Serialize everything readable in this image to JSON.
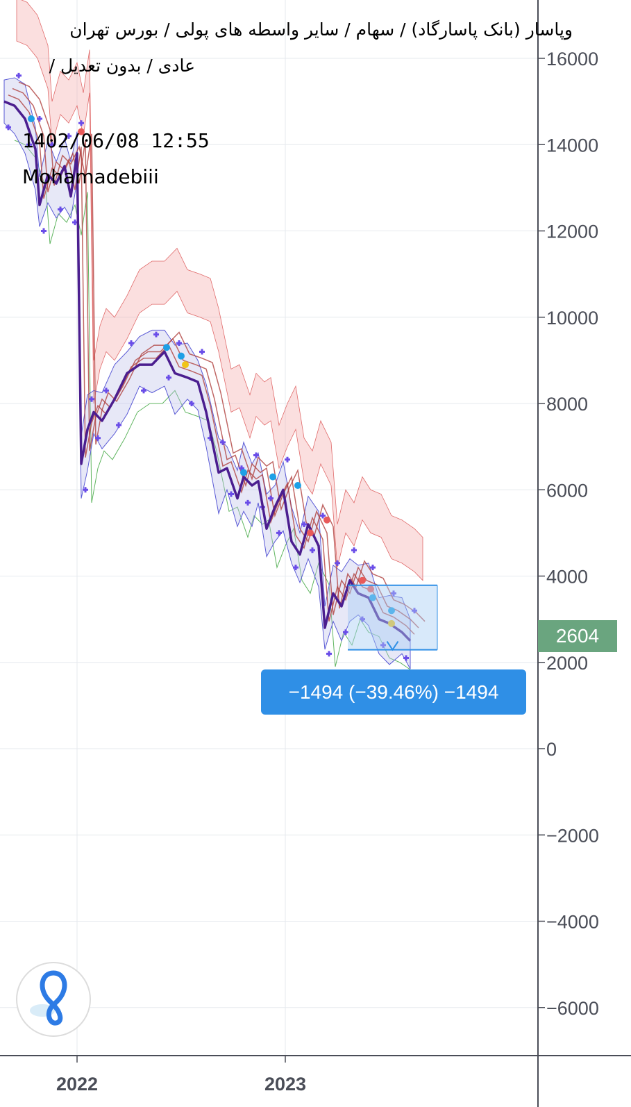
{
  "header": {
    "title_line1": "وپاسار (بانک پاسارگاد) / سهام / سایر واسطه های پولی / بورس تهران",
    "title_line2": "عادی / بدون تعدیل /",
    "datetime": "1402/06/08 12:55",
    "author": "Mohamadebiii"
  },
  "price_badge": {
    "value": "2604",
    "color": "#6aa57f"
  },
  "measurement": {
    "label": "−1494 (−39.46%) −1494",
    "change": -1494,
    "change_percent": -39.46,
    "from_price": 3786,
    "to_price": 2292,
    "color": "#2f8fe6"
  },
  "colors": {
    "price": "#4b1e8f",
    "psar": "#6a4de8",
    "cloud_red": "#f3a3a3",
    "cloud_green": "#8fd08f",
    "bollinger": "#5a5ad6",
    "moving_avg": "#b0413e",
    "grid": "#e6e9ee",
    "axis": "#4a4d57"
  },
  "logo": {
    "icon": "app-logo-icon"
  },
  "chart_data": {
    "type": "line",
    "title": "وپاسار (بانک پاسارگاد) / سهام / سایر واسطه های پولی / بورس تهران",
    "ylim": [
      -7000,
      17000
    ],
    "yticks": [
      16000,
      14000,
      12000,
      10000,
      8000,
      6000,
      4000,
      2000,
      0,
      -2000,
      -4000,
      -6000
    ],
    "xticks": [
      "2022",
      "2023"
    ],
    "grid": true,
    "last_price": 2604,
    "series": [
      {
        "values": [
          [
            2021.65,
            15000
          ],
          [
            2021.7,
            14900
          ],
          [
            2021.75,
            14600
          ],
          [
            2021.8,
            13900
          ],
          [
            2021.82,
            12600
          ],
          [
            2021.86,
            13300
          ],
          [
            2021.9,
            13100
          ],
          [
            2021.94,
            13500
          ],
          [
            2021.97,
            12800
          ],
          [
            2022.0,
            13800
          ],
          [
            2022.02,
            6600
          ],
          [
            2022.05,
            7400
          ],
          [
            2022.08,
            7800
          ],
          [
            2022.12,
            7600
          ],
          [
            2022.18,
            8100
          ],
          [
            2022.24,
            8700
          ],
          [
            2022.3,
            8900
          ],
          [
            2022.36,
            8900
          ],
          [
            2022.42,
            9200
          ],
          [
            2022.47,
            8700
          ],
          [
            2022.53,
            8600
          ],
          [
            2022.58,
            8500
          ],
          [
            2022.62,
            7800
          ],
          [
            2022.68,
            6400
          ],
          [
            2022.72,
            6500
          ],
          [
            2022.77,
            5800
          ],
          [
            2022.8,
            6300
          ],
          [
            2022.84,
            6100
          ],
          [
            2022.87,
            6200
          ],
          [
            2022.91,
            5100
          ],
          [
            2022.95,
            5600
          ],
          [
            2022.99,
            6000
          ],
          [
            2023.03,
            4800
          ],
          [
            2023.07,
            4500
          ],
          [
            2023.11,
            5200
          ],
          [
            2023.16,
            4700
          ],
          [
            2023.19,
            2800
          ],
          [
            2023.23,
            3600
          ],
          [
            2023.27,
            3300
          ],
          [
            2023.31,
            3900
          ],
          [
            2023.35,
            3600
          ],
          [
            2023.4,
            3500
          ],
          [
            2023.45,
            3000
          ],
          [
            2023.5,
            2900
          ],
          [
            2023.56,
            2700
          ],
          [
            2023.6,
            2500
          ]
        ]
      }
    ]
  }
}
